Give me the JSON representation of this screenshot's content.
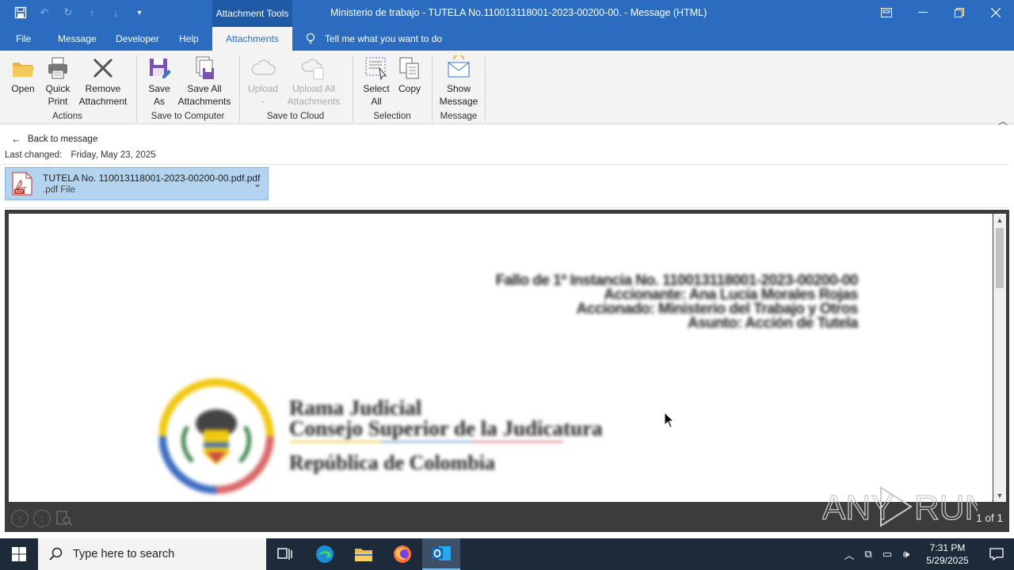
{
  "titlebar": {
    "context_tab": "Attachment Tools",
    "window_title": "Ministerio de trabajo - TUTELA No.110013118001-2023-00200-00.  -  Message (HTML)",
    "qat": [
      "save-icon",
      "undo-icon",
      "redo-icon",
      "up-icon",
      "down-icon",
      "customize-icon"
    ]
  },
  "tabs": {
    "file": "File",
    "message": "Message",
    "developer": "Developer",
    "help": "Help",
    "attachments": "Attachments",
    "tell_me": "Tell me what you want to do"
  },
  "ribbon": {
    "actions": {
      "open": "Open",
      "quick_print_1": "Quick",
      "quick_print_2": "Print",
      "remove_1": "Remove",
      "remove_2": "Attachment",
      "label": "Actions"
    },
    "save_to_computer": {
      "save_as_1": "Save",
      "save_as_2": "As",
      "save_all_1": "Save All",
      "save_all_2": "Attachments",
      "label": "Save to Computer"
    },
    "save_to_cloud": {
      "upload": "Upload",
      "upload_all_1": "Upload All",
      "upload_all_2": "Attachments",
      "label": "Save to Cloud"
    },
    "selection": {
      "select_all_1": "Select",
      "select_all_2": "All",
      "copy": "Copy",
      "label": "Selection"
    },
    "message": {
      "show_message_1": "Show",
      "show_message_2": "Message",
      "label": "Message"
    }
  },
  "content": {
    "back_to_message": "Back to message",
    "last_changed_label": "Last changed:",
    "last_changed_value": "Friday, May 23, 2025",
    "attachment": {
      "name": "TUTELA No. 110013118001-2023-00200-00.pdf.pdf",
      "type": ".pdf File"
    }
  },
  "document": {
    "header_lines": [
      "Fallo de 1ª Instancia No. 110013118001-2023-00200-00",
      "Accionante: Ana Lucía Morales Rojas",
      "Accionado: Ministerio del Trabajo y Otros",
      "Asunto: Acción de Tutela"
    ],
    "rama_line1": "Rama Judicial",
    "rama_line2": "Consejo Superior de la Judicatura",
    "republica": "República de Colombia"
  },
  "viewer": {
    "page_count": "1 of 1"
  },
  "watermark": "ANY RUN",
  "taskbar": {
    "search_placeholder": "Type here to search",
    "time": "7:31 PM",
    "date": "5/29/2025"
  }
}
